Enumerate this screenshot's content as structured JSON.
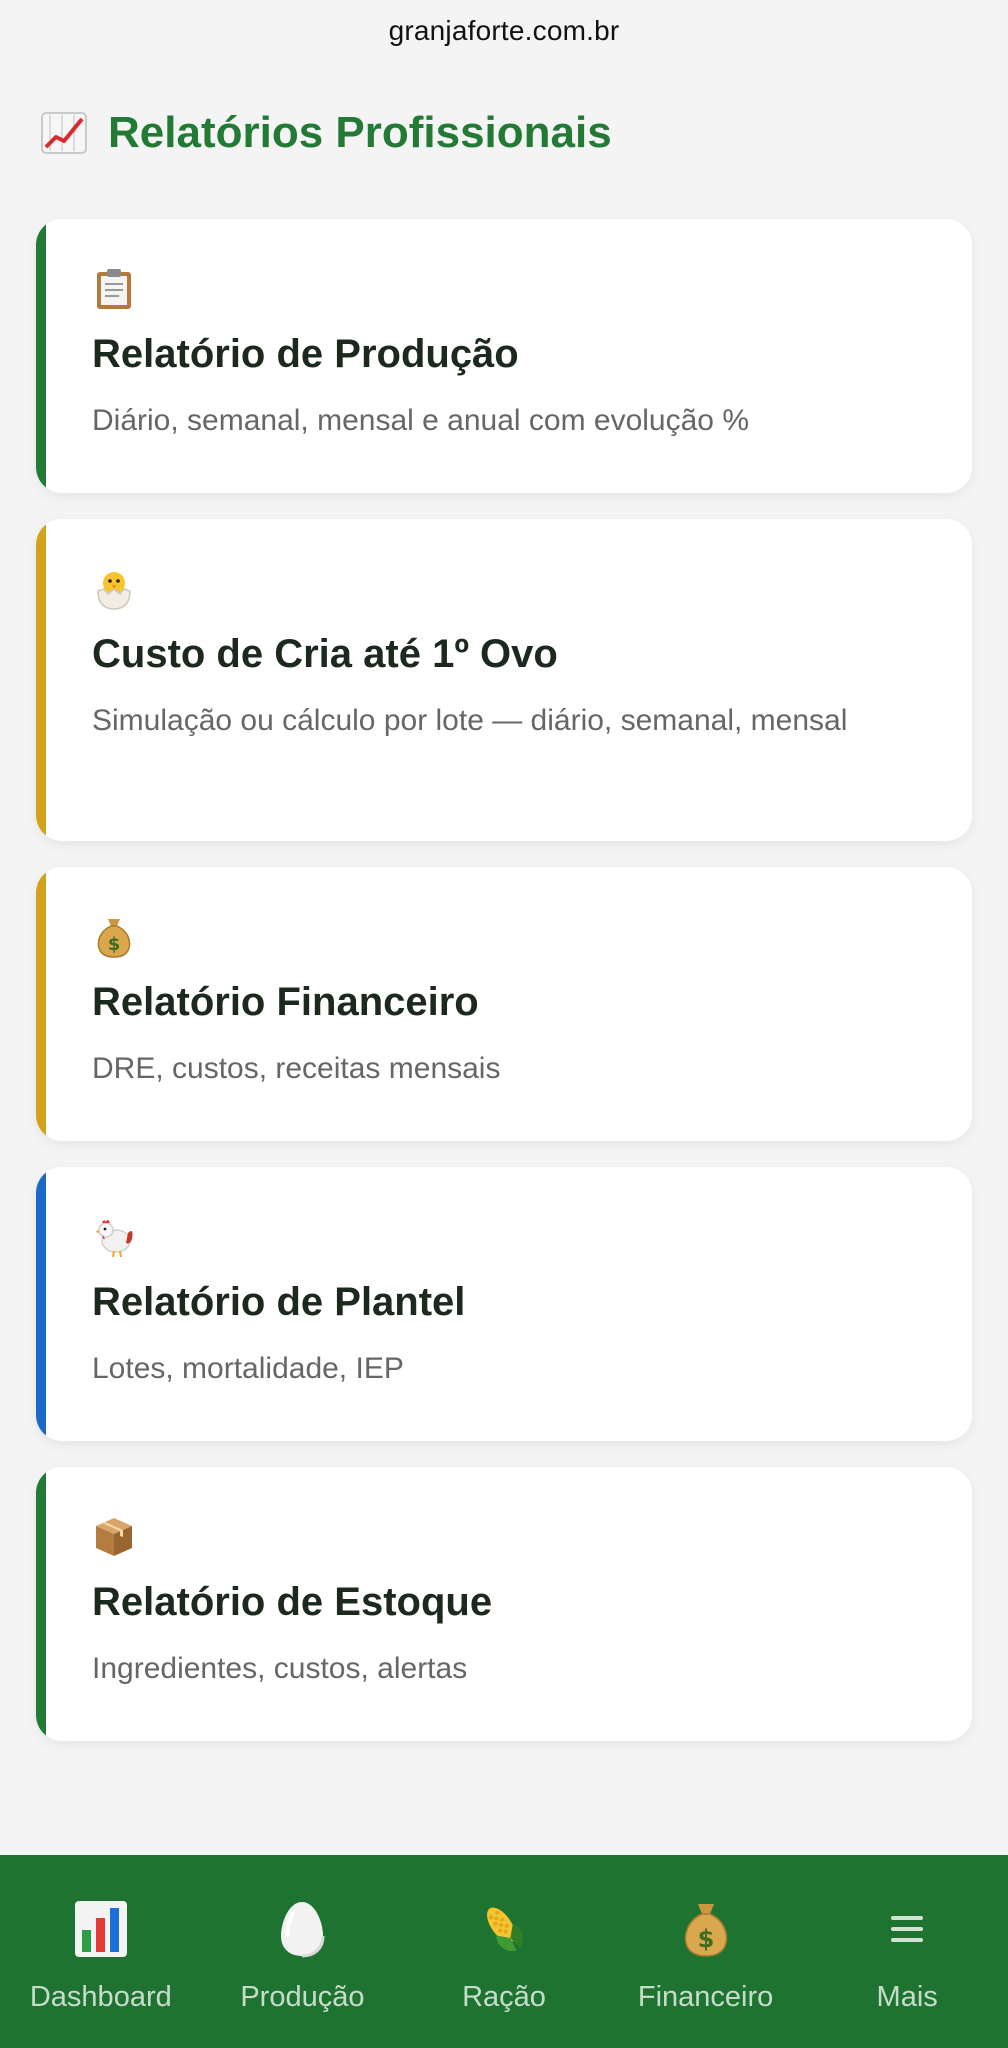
{
  "browser": {
    "url": "granjaforte.com.br"
  },
  "header": {
    "title": "Relatórios Profissionais",
    "icon": "chart-up-icon"
  },
  "colors": {
    "brand_green": "#237a35",
    "nav_green": "#1e7330",
    "accent_green": "#237a35",
    "accent_gold": "#d4a21a",
    "accent_blue": "#1b6ac9"
  },
  "reports": [
    {
      "icon": "clipboard-icon",
      "title": "Relatório de Produção",
      "description": "Diário, semanal, mensal e anual com evolução %",
      "accent": "#237a35"
    },
    {
      "icon": "hatching-chick-icon",
      "title": "Custo de Cria até 1º Ovo",
      "description": "Simulação ou cálculo por lote — diário, semanal, mensal",
      "accent": "#d4a21a"
    },
    {
      "icon": "money-bag-icon",
      "title": "Relatório Financeiro",
      "description": "DRE, custos, receitas mensais",
      "accent": "#d4a21a"
    },
    {
      "icon": "rooster-icon",
      "title": "Relatório de Plantel",
      "description": "Lotes, mortalidade, IEP",
      "accent": "#1b6ac9"
    },
    {
      "icon": "package-icon",
      "title": "Relatório de Estoque",
      "description": "Ingredientes, custos, alertas",
      "accent": "#237a35"
    }
  ],
  "nav": [
    {
      "label": "Dashboard",
      "icon": "bar-chart-icon"
    },
    {
      "label": "Produção",
      "icon": "egg-icon"
    },
    {
      "label": "Ração",
      "icon": "corn-icon"
    },
    {
      "label": "Financeiro",
      "icon": "money-bag-icon"
    },
    {
      "label": "Mais",
      "icon": "menu-icon"
    }
  ]
}
